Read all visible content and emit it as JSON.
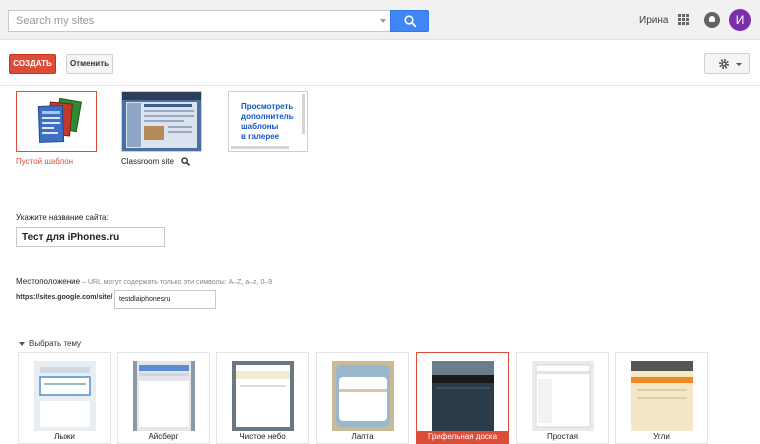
{
  "header": {
    "search_placeholder": "Search my sites",
    "user_name": "Ирина",
    "avatar_initial": "И"
  },
  "toolbar": {
    "create_label": "СОЗДАТЬ",
    "cancel_label": "Отменить"
  },
  "templates": [
    {
      "label": "Пустой шаблон",
      "selected": true
    },
    {
      "label": "Classroom site",
      "selected": false
    },
    {
      "label": "Просмотреть дополнительные шаблоны в галерее",
      "lines": [
        "Просмотреть",
        "дополнитель",
        "шаблоны",
        "в галерее"
      ]
    }
  ],
  "form": {
    "site_name_label": "Укажите название сайта:",
    "site_name_value": "Тест для iPhones.ru",
    "location_label": "Местоположение",
    "location_hint": " – URL могут содержать только эти символы: A–Z, a–z, 0–9",
    "url_prefix": "https://sites.google.com/site/",
    "url_value": "testdlaiphonesru"
  },
  "themes_toggle": "Выбрать тему",
  "themes": [
    {
      "name": "Лыжи",
      "selected": false
    },
    {
      "name": "Айсберг",
      "selected": false
    },
    {
      "name": "Чистое небо",
      "selected": false
    },
    {
      "name": "Лапта",
      "selected": false
    },
    {
      "name": "Грифельная доска",
      "selected": true
    },
    {
      "name": "Простая",
      "selected": false
    },
    {
      "name": "Угли",
      "selected": false
    }
  ],
  "colors": {
    "accent_red": "#dd4b39",
    "search_blue": "#4285f4",
    "avatar_purple": "#7b2ea8",
    "link_blue": "#1155cc"
  },
  "icons": [
    "search-icon",
    "apps-grid-icon",
    "notifications-icon",
    "gear-icon",
    "magnifier-icon",
    "caret-down-icon"
  ]
}
